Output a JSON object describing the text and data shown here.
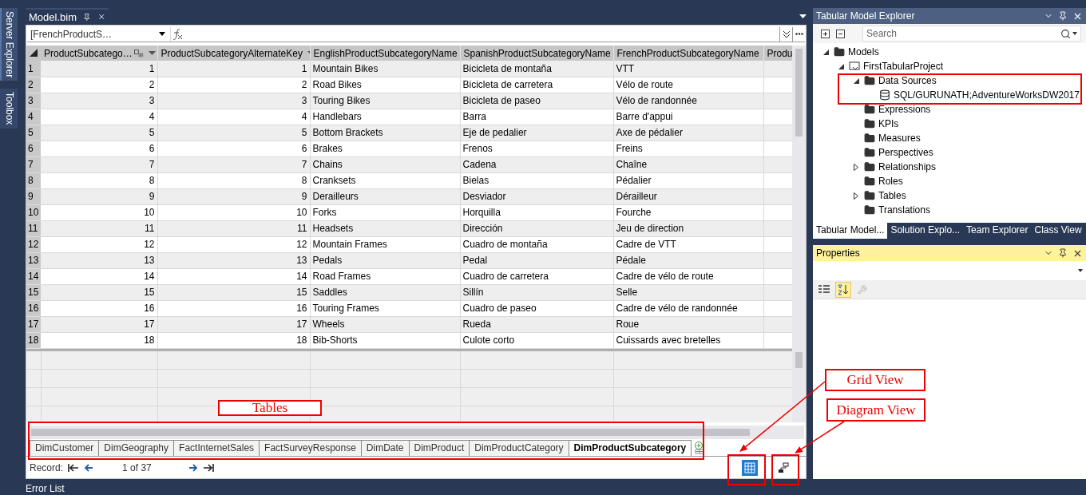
{
  "side_tabs": [
    {
      "label": "Server Explorer",
      "selected": true
    },
    {
      "label": "Toolbox",
      "selected": false
    }
  ],
  "document_tab": {
    "title": "Model.bim"
  },
  "formula_bar": {
    "column_selector": "[FrenchProductS…"
  },
  "grid": {
    "columns": [
      {
        "label": "ProductSubcatego…",
        "kind": "key"
      },
      {
        "label": "ProductSubcategoryAlternateKey",
        "kind": "plain"
      },
      {
        "label": "EnglishProductSubcategoryName",
        "kind": "plain"
      },
      {
        "label": "SpanishProductSubcategoryName",
        "kind": "plain"
      },
      {
        "label": "FrenchProductSubcategoryName",
        "kind": "plain"
      },
      {
        "label": "Produ",
        "kind": "cut"
      }
    ],
    "rows": [
      {
        "number": "1",
        "cells": [
          "1",
          "1",
          "Mountain Bikes",
          "Bicicleta de montaña",
          "VTT"
        ]
      },
      {
        "number": "2",
        "cells": [
          "2",
          "2",
          "Road Bikes",
          "Bicicleta de carretera",
          "Vélo de route"
        ]
      },
      {
        "number": "3",
        "cells": [
          "3",
          "3",
          "Touring Bikes",
          "Bicicleta de paseo",
          "Vélo de randonnée"
        ]
      },
      {
        "number": "4",
        "cells": [
          "4",
          "4",
          "Handlebars",
          "Barra",
          "Barre d'appui"
        ]
      },
      {
        "number": "5",
        "cells": [
          "5",
          "5",
          "Bottom Brackets",
          "Eje de pedalier",
          "Axe de pédalier"
        ]
      },
      {
        "number": "6",
        "cells": [
          "6",
          "6",
          "Brakes",
          "Frenos",
          "Freins"
        ]
      },
      {
        "number": "7",
        "cells": [
          "7",
          "7",
          "Chains",
          "Cadena",
          "Chaîne"
        ]
      },
      {
        "number": "8",
        "cells": [
          "8",
          "8",
          "Cranksets",
          "Bielas",
          "Pédalier"
        ]
      },
      {
        "number": "9",
        "cells": [
          "9",
          "9",
          "Derailleurs",
          "Desviador",
          "Dérailleur"
        ]
      },
      {
        "number": "10",
        "cells": [
          "10",
          "10",
          "Forks",
          "Horquilla",
          "Fourche"
        ]
      },
      {
        "number": "11",
        "cells": [
          "11",
          "11",
          "Headsets",
          "Dirección",
          "Jeu de direction"
        ]
      },
      {
        "number": "12",
        "cells": [
          "12",
          "12",
          "Mountain Frames",
          "Cuadro de montaña",
          "Cadre de VTT"
        ]
      },
      {
        "number": "13",
        "cells": [
          "13",
          "13",
          "Pedals",
          "Pedal",
          "Pédale"
        ]
      },
      {
        "number": "14",
        "cells": [
          "14",
          "14",
          "Road Frames",
          "Cuadro de carretera",
          "Cadre de vélo de route"
        ]
      },
      {
        "number": "15",
        "cells": [
          "15",
          "15",
          "Saddles",
          "Sillín",
          "Selle"
        ]
      },
      {
        "number": "16",
        "cells": [
          "16",
          "16",
          "Touring Frames",
          "Cuadro de paseo",
          "Cadre de vélo de randonnée"
        ]
      },
      {
        "number": "17",
        "cells": [
          "17",
          "17",
          "Wheels",
          "Rueda",
          "Roue"
        ]
      },
      {
        "number": "18",
        "cells": [
          "18",
          "18",
          "Bib-Shorts",
          "Culote corto",
          "Cuissards avec bretelles"
        ]
      }
    ]
  },
  "sheet_tabs": [
    {
      "label": "DimCustomer",
      "selected": false
    },
    {
      "label": "DimGeography",
      "selected": false
    },
    {
      "label": "FactInternetSales",
      "selected": false
    },
    {
      "label": "FactSurveyResponse",
      "selected": false
    },
    {
      "label": "DimDate",
      "selected": false
    },
    {
      "label": "DimProduct",
      "selected": false
    },
    {
      "label": "DimProductCategory",
      "selected": false
    },
    {
      "label": "DimProductSubcategory",
      "selected": true
    }
  ],
  "record_bar": {
    "label": "Record:",
    "position": "1 of 37"
  },
  "view_buttons": [
    {
      "kind": "grid",
      "selected": true
    },
    {
      "kind": "diagram",
      "selected": false
    }
  ],
  "explorer": {
    "title": "Tabular Model Explorer",
    "search": {
      "placeholder": "Search"
    },
    "tree": [
      {
        "label": "Models",
        "kind": "folder",
        "expanded": true,
        "children": [
          {
            "label": "FirstTabularProject",
            "kind": "project",
            "expanded": true,
            "children": [
              {
                "label": "Data Sources",
                "kind": "folder",
                "expanded": true,
                "children": [
                  {
                    "label": "SQL/GURUNATH;AdventureWorksDW2017",
                    "kind": "datasource"
                  }
                ]
              },
              {
                "label": "Expressions",
                "kind": "folder"
              },
              {
                "label": "KPIs",
                "kind": "folder"
              },
              {
                "label": "Measures",
                "kind": "folder"
              },
              {
                "label": "Perspectives",
                "kind": "folder"
              },
              {
                "label": "Relationships",
                "kind": "folder",
                "expanded": false
              },
              {
                "label": "Roles",
                "kind": "folder"
              },
              {
                "label": "Tables",
                "kind": "folder",
                "expanded": false
              },
              {
                "label": "Translations",
                "kind": "folder"
              }
            ]
          }
        ]
      }
    ],
    "tabs": [
      {
        "label": "Tabular Model...",
        "selected": true
      },
      {
        "label": "Solution Explo...",
        "selected": false
      },
      {
        "label": "Team Explorer",
        "selected": false
      },
      {
        "label": "Class View",
        "selected": false
      }
    ]
  },
  "properties": {
    "title": "Properties"
  },
  "bottom_bar": {
    "label": "Error List"
  },
  "annotations": [
    {
      "text": "Tables"
    },
    {
      "text": "Grid View"
    },
    {
      "text": "Diagram View"
    }
  ]
}
